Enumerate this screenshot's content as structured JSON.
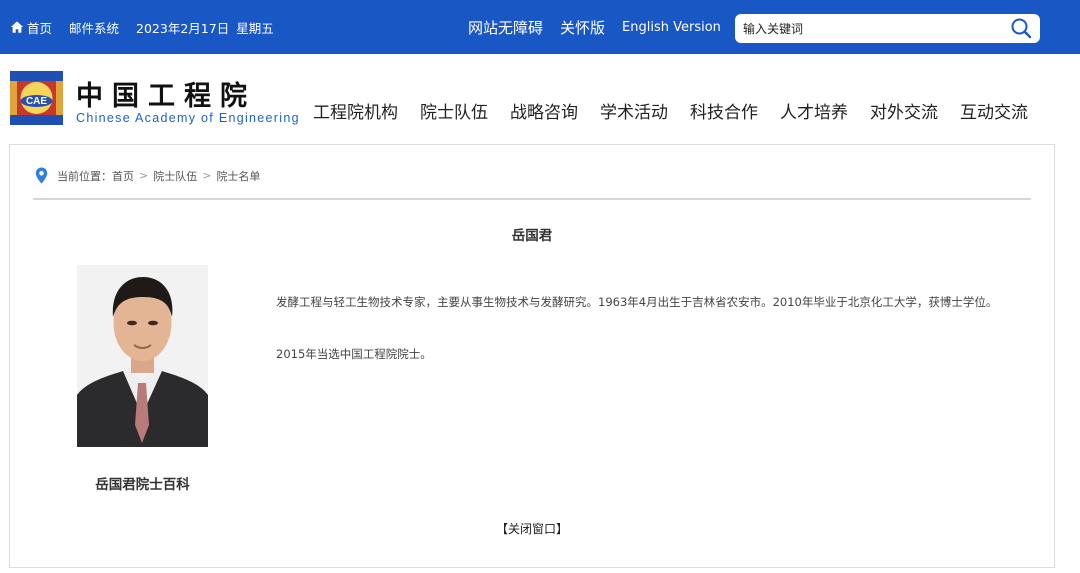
{
  "topbar": {
    "home": "首页",
    "mail": "邮件系统",
    "date": "2023年2月17日",
    "weekday": "星期五",
    "accessibility": "网站无障碍",
    "care": "关怀版",
    "english": "English Version",
    "search_placeholder": "输入关键词"
  },
  "header": {
    "logo_cn": "中国工程院",
    "logo_en": "Chinese Academy of Engineering",
    "logo_badge": "CAE",
    "nav": [
      "工程院机构",
      "院士队伍",
      "战略咨询",
      "学术活动",
      "科技合作",
      "人才培养",
      "对外交流",
      "互动交流"
    ]
  },
  "breadcrumb": {
    "prefix": "当前位置：",
    "items": [
      "首页",
      "院士队伍",
      "院士名单"
    ]
  },
  "article": {
    "title": "岳国君",
    "paragraphs": [
      "发酵工程与轻工生物技术专家，主要从事生物技术与发酵研究。1963年4月出生于吉林省农安市。2010年毕业于北京化工大学，获博士学位。",
      "2015年当选中国工程院院士。"
    ],
    "baike_link": "岳国君院士百科",
    "close_button": "【关闭窗口】"
  },
  "colors": {
    "topbar_bg": "#1857c4",
    "logo_en": "#1c63c6",
    "pin": "#2d7fe0"
  },
  "icons": {
    "home": "home-icon",
    "search": "search-icon",
    "location": "location-pin-icon"
  }
}
